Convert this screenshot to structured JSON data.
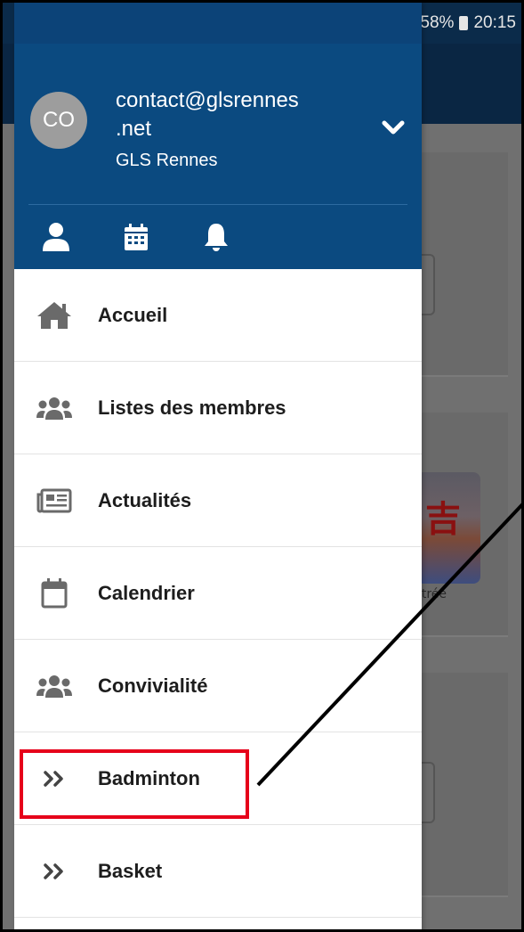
{
  "status_bar": {
    "battery": "58%",
    "time": "20:15"
  },
  "account": {
    "initials": "CO",
    "email": "contact@glsrennes\n.net",
    "organization": "GLS Rennes"
  },
  "quick_actions": [
    "profile-icon",
    "calendar-icon",
    "bell-icon"
  ],
  "menu": {
    "items": [
      {
        "label": "Accueil",
        "icon": "home-icon"
      },
      {
        "label": "Listes des membres",
        "icon": "users-icon"
      },
      {
        "label": "Actualités",
        "icon": "newspaper-icon"
      },
      {
        "label": "Calendrier",
        "icon": "calendar-outline-icon"
      },
      {
        "label": "Convivialité",
        "icon": "users-icon"
      },
      {
        "label": "Badminton",
        "icon": "double-chevron-right-icon"
      },
      {
        "label": "Basket",
        "icon": "double-chevron-right-icon"
      }
    ]
  },
  "background": {
    "thumbnail_caption": "ntrée"
  },
  "colors": {
    "header_blue": "#0b4a80",
    "toolbar_dark": "#0a2643",
    "highlight_red": "#e6001a",
    "icon_gray": "#666666"
  }
}
